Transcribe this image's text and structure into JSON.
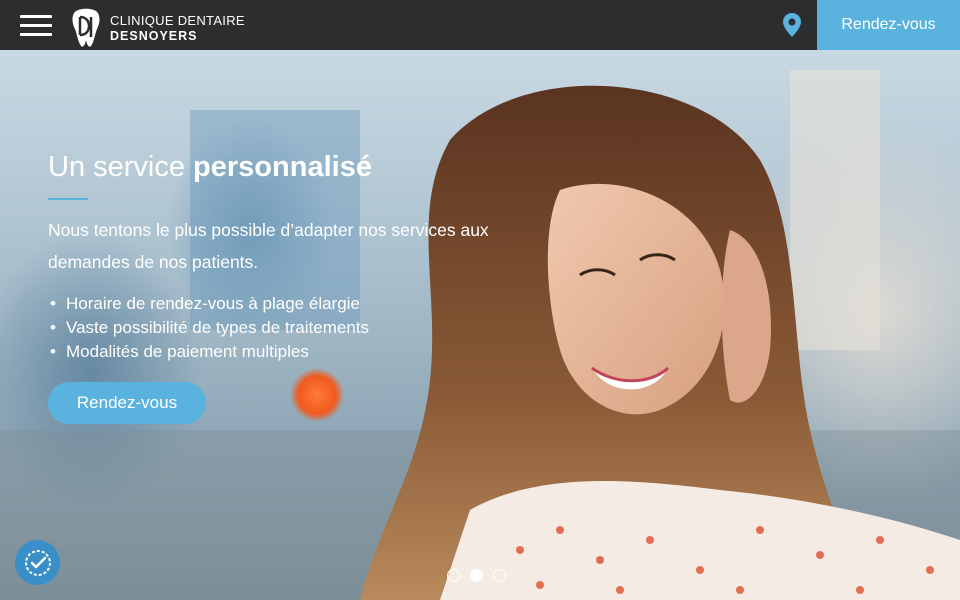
{
  "header": {
    "brand_line1": "CLINIQUE DENTAIRE",
    "brand_line2": "DESNOYERS",
    "cta_label": "Rendez-vous",
    "menu_icon": "hamburger-menu-icon",
    "location_icon": "map-pin-icon"
  },
  "hero": {
    "title_regular": "Un service ",
    "title_bold": "personnalisé",
    "description": "Nous tentons le plus possible d’adapter nos services aux demandes de nos patients.",
    "bullets": [
      "Horaire de rendez-vous à plage élargie",
      "Vaste possibilité de types de traitements",
      "Modalités de paiement multiples"
    ],
    "button_label": "Rendez-vous"
  },
  "carousel": {
    "slide_count": 3,
    "active_index": 2
  },
  "accessibility": {
    "icon": "accessibility-check-icon"
  },
  "colors": {
    "header_bg": "#2c2d2e",
    "accent": "#5ab2de",
    "pin": "#5ab2de",
    "accessibility_bg": "#3a8fc9"
  }
}
